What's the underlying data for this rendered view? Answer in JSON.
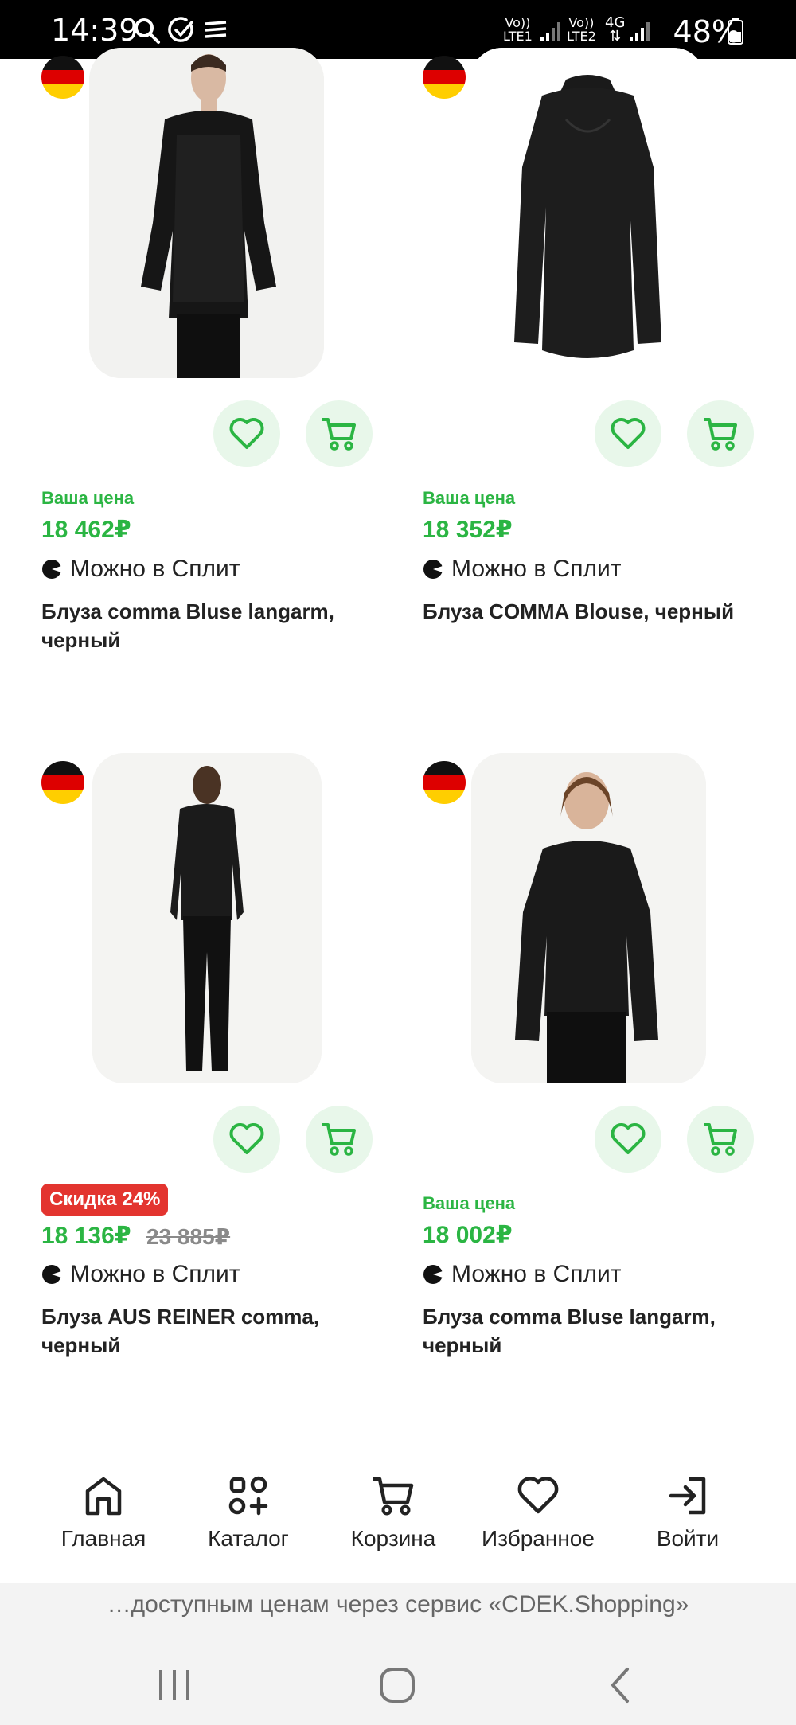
{
  "status_bar": {
    "time": "14:39",
    "sim1_top": "Vo))",
    "sim1_bottom": "LTE1",
    "sim2_top": "Vo))",
    "sim2_bottom": "LTE2",
    "network": "4G",
    "battery": "48%",
    "icons": [
      "search-icon",
      "check-circle-icon",
      "stack-icon",
      "signal-icon",
      "battery-icon"
    ]
  },
  "products": [
    {
      "price_label": "Ваша цена",
      "price": "18 462₽",
      "split": "Можно в Сплит",
      "title": "Блуза comma Bluse langarm, черный",
      "origin": "germany-flag"
    },
    {
      "price_label": "Ваша цена",
      "price": "18 352₽",
      "split": "Можно в Сплит",
      "title": "Блуза COMMA Blouse, черный",
      "origin": "germany-flag"
    },
    {
      "discount": "Скидка 24%",
      "price": "18 136₽",
      "old_price": "23 885₽",
      "split": "Можно в Сплит",
      "title": "Блуза AUS REINER comma, черный",
      "origin": "germany-flag"
    },
    {
      "price_label": "Ваша цена",
      "price": "18 002₽",
      "split": "Можно в Сплит",
      "title": "Блуза comma Bluse langarm, черный",
      "origin": "germany-flag"
    }
  ],
  "bottom_nav": {
    "items": [
      {
        "label": "Главная",
        "icon": "home-icon"
      },
      {
        "label": "Каталог",
        "icon": "catalog-icon"
      },
      {
        "label": "Корзина",
        "icon": "cart-icon"
      },
      {
        "label": "Избранное",
        "icon": "heart-icon"
      },
      {
        "label": "Войти",
        "icon": "login-icon"
      }
    ]
  },
  "banner": "…доступным ценам через сервис «CDEK.Shopping»",
  "colors": {
    "accent_green": "#2bb543",
    "button_bg": "#e8f7ea",
    "discount_red": "#e3342f"
  }
}
